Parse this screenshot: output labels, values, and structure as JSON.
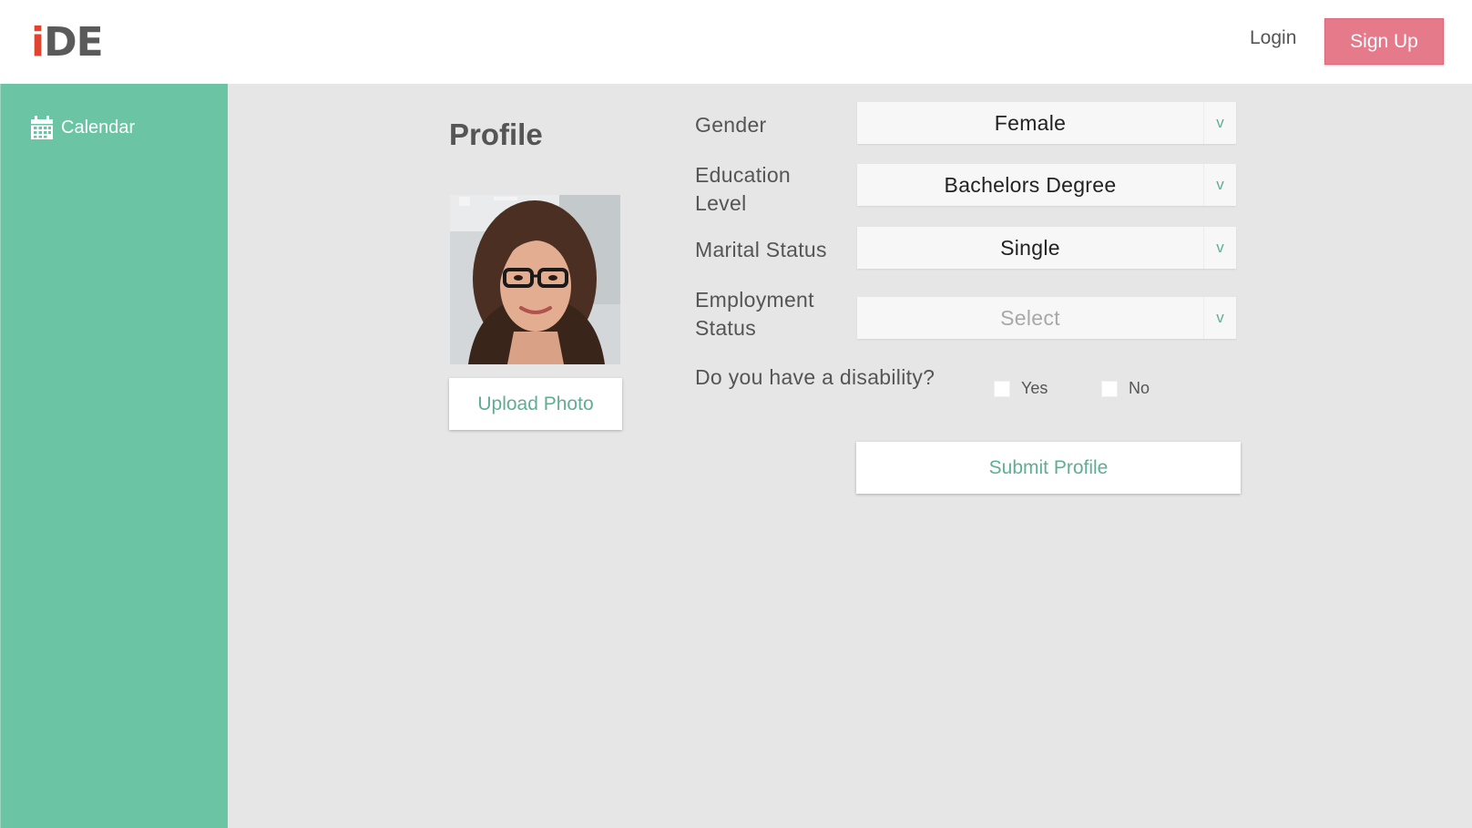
{
  "brand": {
    "logo_i": "i",
    "logo_rest": "DE"
  },
  "header": {
    "login_label": "Login",
    "signup_label": "Sign Up"
  },
  "sidebar": {
    "items": [
      {
        "label": "Calendar",
        "icon": "calendar-icon"
      }
    ]
  },
  "profile": {
    "title": "Profile",
    "upload_label": "Upload Photo",
    "photo": "profile-photo-woman-with-glasses"
  },
  "form": {
    "gender": {
      "label": "Gender",
      "value": "Female"
    },
    "education": {
      "label_line1": "Education",
      "label_line2": "Level",
      "value": "Bachelors Degree"
    },
    "marital": {
      "label": "Marital Status",
      "value": "Single"
    },
    "employment": {
      "label_line1": "Employment",
      "label_line2": "Status",
      "placeholder": "Select"
    },
    "chevron": "v",
    "disability": {
      "question": "Do you have a disability?",
      "yes_label": "Yes",
      "no_label": "No"
    },
    "submit_label": "Submit Profile"
  },
  "colors": {
    "accent_green": "#6bc4a3",
    "signup_pink": "#e47a8a",
    "logo_red": "#e0442f",
    "logo_gray": "#5a5a5a",
    "background_gray": "#e6e6e6"
  }
}
